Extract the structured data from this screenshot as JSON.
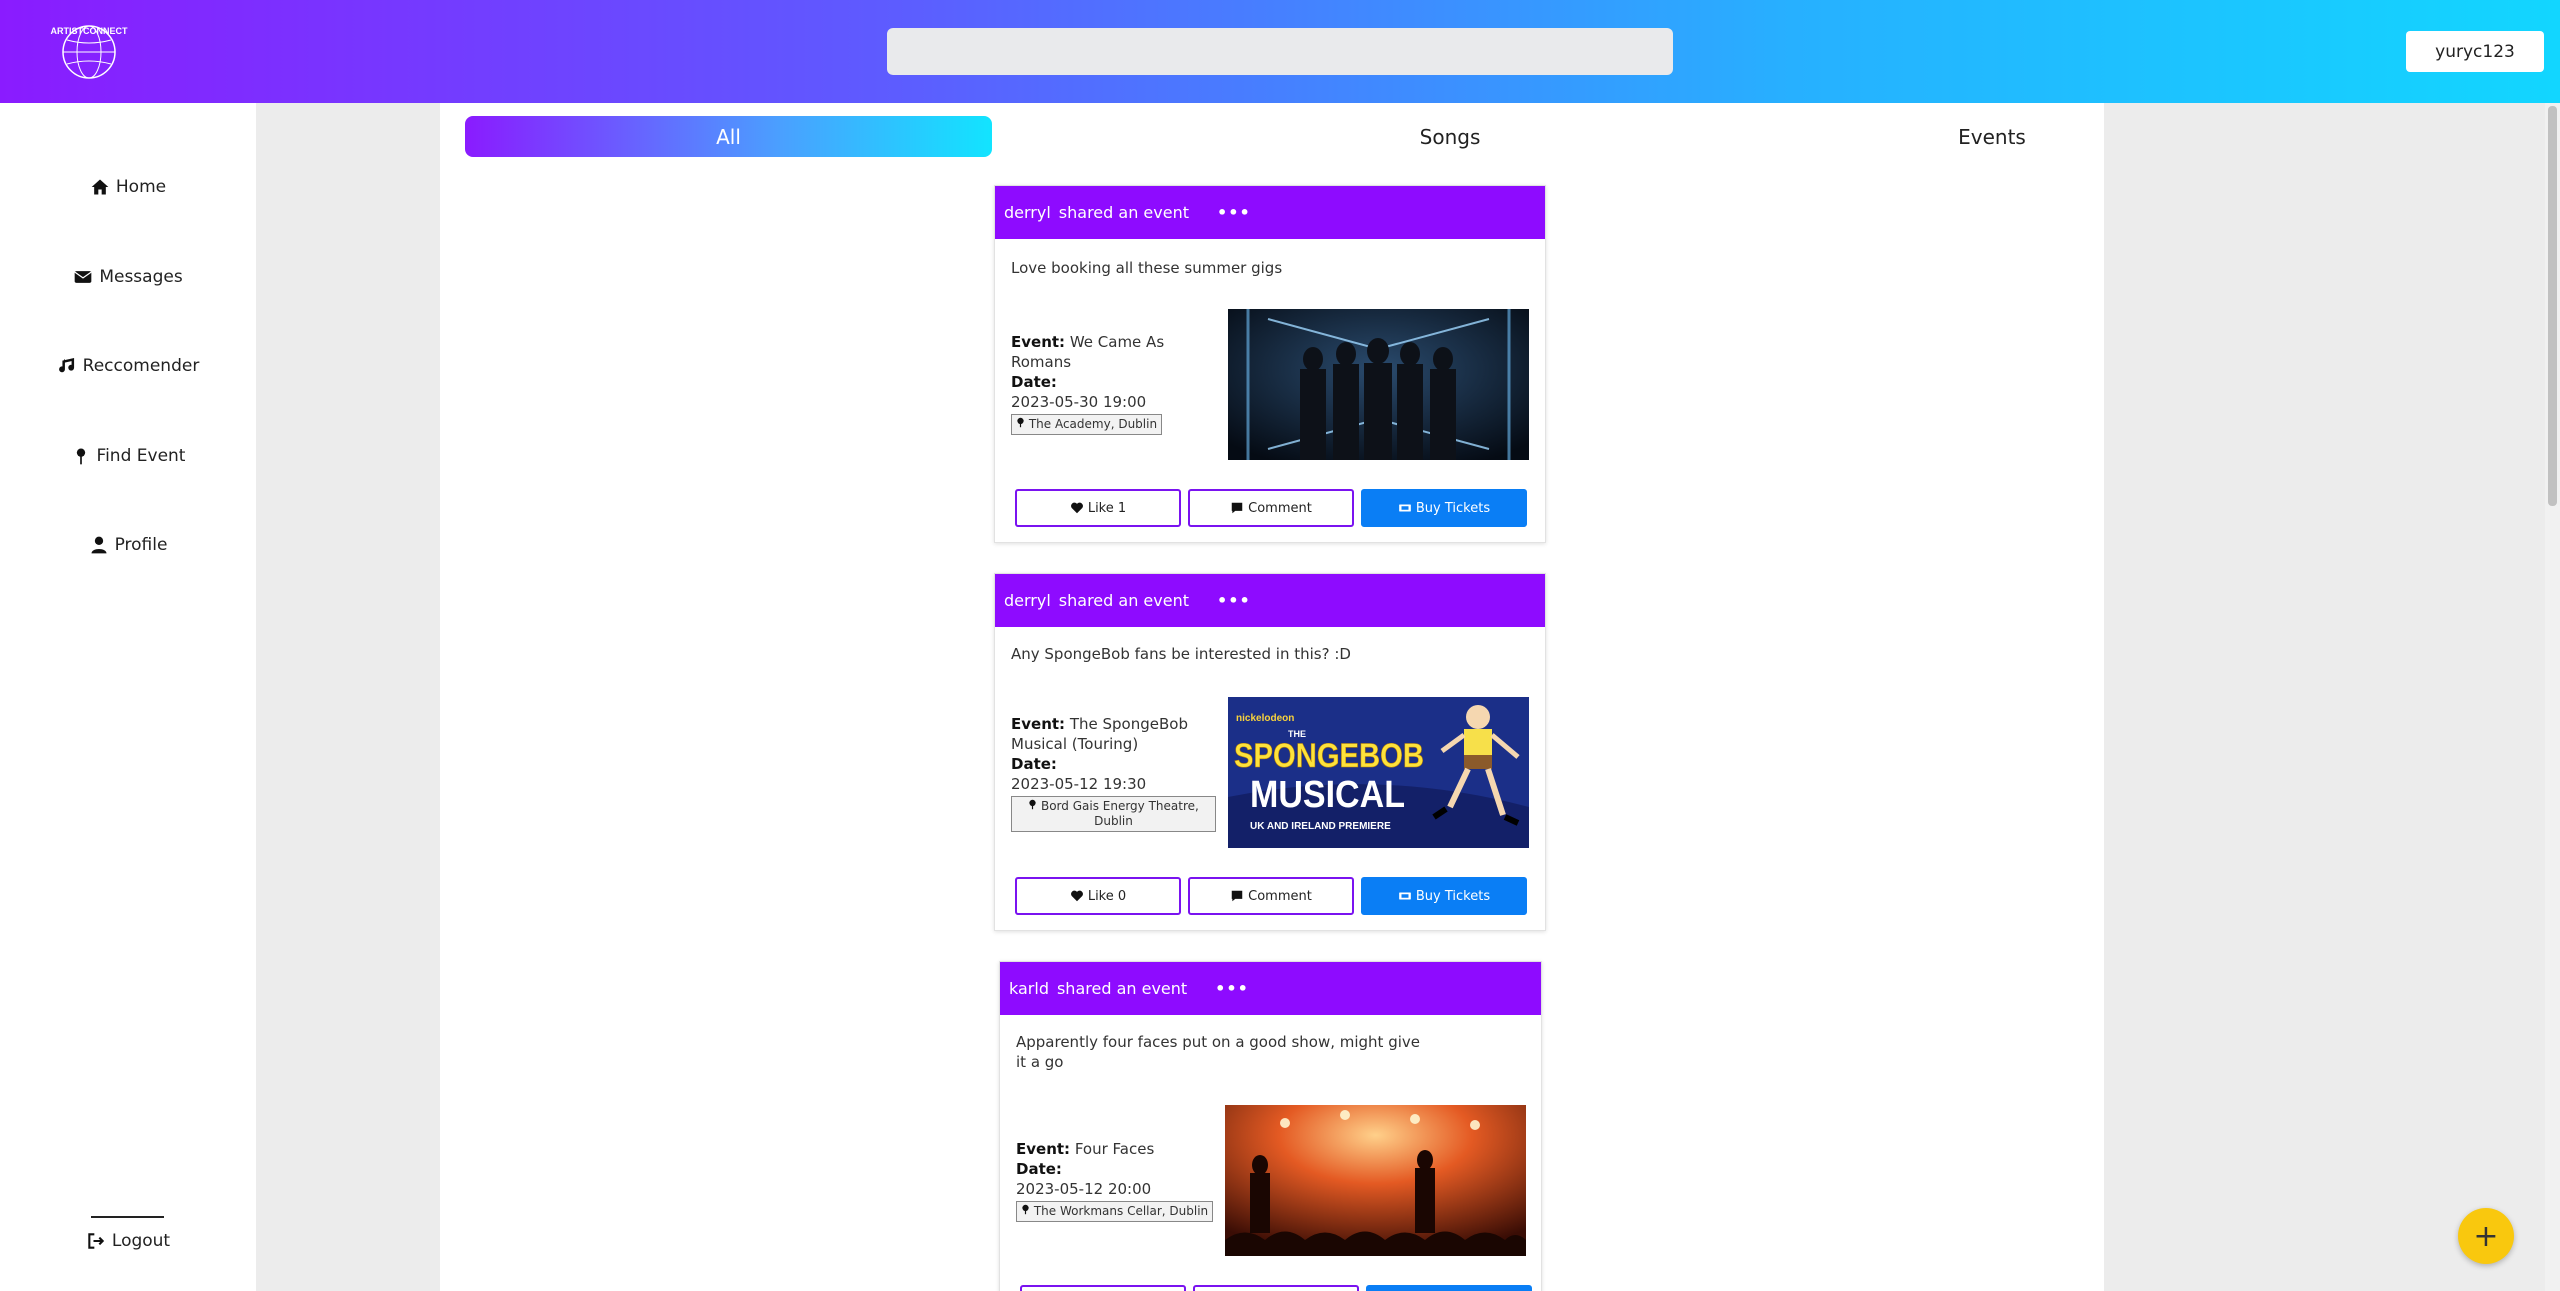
{
  "header": {
    "logo_text": "ARTISTCONNECT",
    "search_placeholder": "",
    "user_label": "yuryc123"
  },
  "sidebar": {
    "items": [
      {
        "label": "Home",
        "icon": "home-icon"
      },
      {
        "label": "Messages",
        "icon": "envelope-icon"
      },
      {
        "label": "Reccomender",
        "icon": "music-note-icon"
      },
      {
        "label": "Find Event",
        "icon": "map-pin-icon"
      },
      {
        "label": "Profile",
        "icon": "user-icon"
      }
    ],
    "logout_label": "Logout"
  },
  "tabs": [
    {
      "label": "All",
      "active": true
    },
    {
      "label": "Songs",
      "active": false
    },
    {
      "label": "Events",
      "active": false
    }
  ],
  "posts": [
    {
      "user": "derryl",
      "action": "shared an event",
      "menu": "•••",
      "text": "Love booking all these summer gigs",
      "event_label": "Event:",
      "event_name": "We Came As Romans",
      "date_label": "Date:",
      "date": "2023-05-30 19:00",
      "location": "The Academy, Dublin",
      "like_label": "Like 1",
      "comment_label": "Comment",
      "buy_label": "Buy Tickets"
    },
    {
      "user": "derryl",
      "action": "shared an event",
      "menu": "•••",
      "text": "Any SpongeBob fans be interested in this? :D",
      "event_label": "Event:",
      "event_name": "The SpongeBob Musical (Touring)",
      "date_label": "Date:",
      "date": "2023-05-12 19:30",
      "location": "Bord Gais Energy Theatre, Dublin",
      "like_label": "Like 0",
      "comment_label": "Comment",
      "buy_label": "Buy Tickets",
      "poster": {
        "brand": "nickelodeon",
        "title_top": "THE",
        "title_main": "SPONGEBOB",
        "title_sub": "MUSICAL",
        "tagline": "UK AND IRELAND PREMIERE"
      }
    },
    {
      "user": "karld",
      "action": "shared an event",
      "menu": "•••",
      "text": "Apparently four faces put on a good show, might give it a go",
      "event_label": "Event:",
      "event_name": "Four Faces",
      "date_label": "Date:",
      "date": "2023-05-12 20:00",
      "location": "The Workmans Cellar, Dublin"
    }
  ],
  "fab_label": "+",
  "colors": {
    "post_header": "#8e0bff",
    "buy_button": "#0a7ef5",
    "fab": "#f9c80e"
  }
}
